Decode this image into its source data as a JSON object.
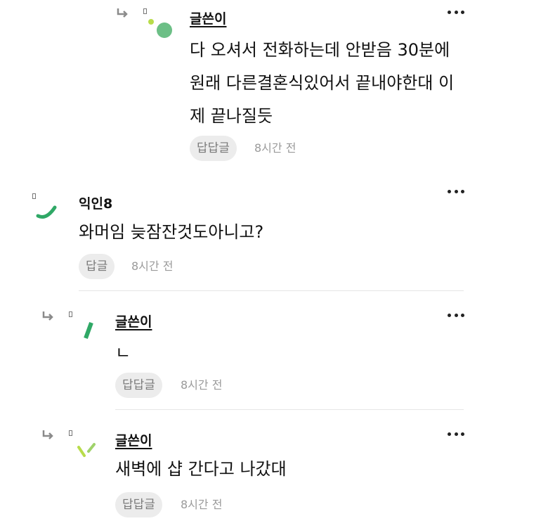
{
  "comments": [
    {
      "author": "글쓴이",
      "lines": [
        "다 오셔서 전화하는데 안받음 30분에",
        "원래 다른결혼식있어서 끝내야한대 이",
        "제 끝나질듯"
      ],
      "reply_label": "답답글",
      "time": "8시간 전"
    },
    {
      "author": "익인8",
      "lines": [
        "와머임 늦잠잔것도아니고?"
      ],
      "reply_label": "답글",
      "time": "8시간 전"
    },
    {
      "author": "글쓴이",
      "lines": [
        "ㄴ"
      ],
      "reply_label": "답답글",
      "time": "8시간 전"
    },
    {
      "author": "글쓴이",
      "lines": [
        "새벽에 샵 간다고 나갔대"
      ],
      "reply_label": "답답글",
      "time": "8시간 전"
    }
  ],
  "icons": {
    "reply_arrow": "reply-arrow-icon",
    "more": "more-options-icon",
    "avatar": "avatar-icon"
  },
  "colors": {
    "avatar_green": "#2fa866",
    "avatar_light_green": "#9fd26a",
    "reply_bg": "#ececec"
  }
}
